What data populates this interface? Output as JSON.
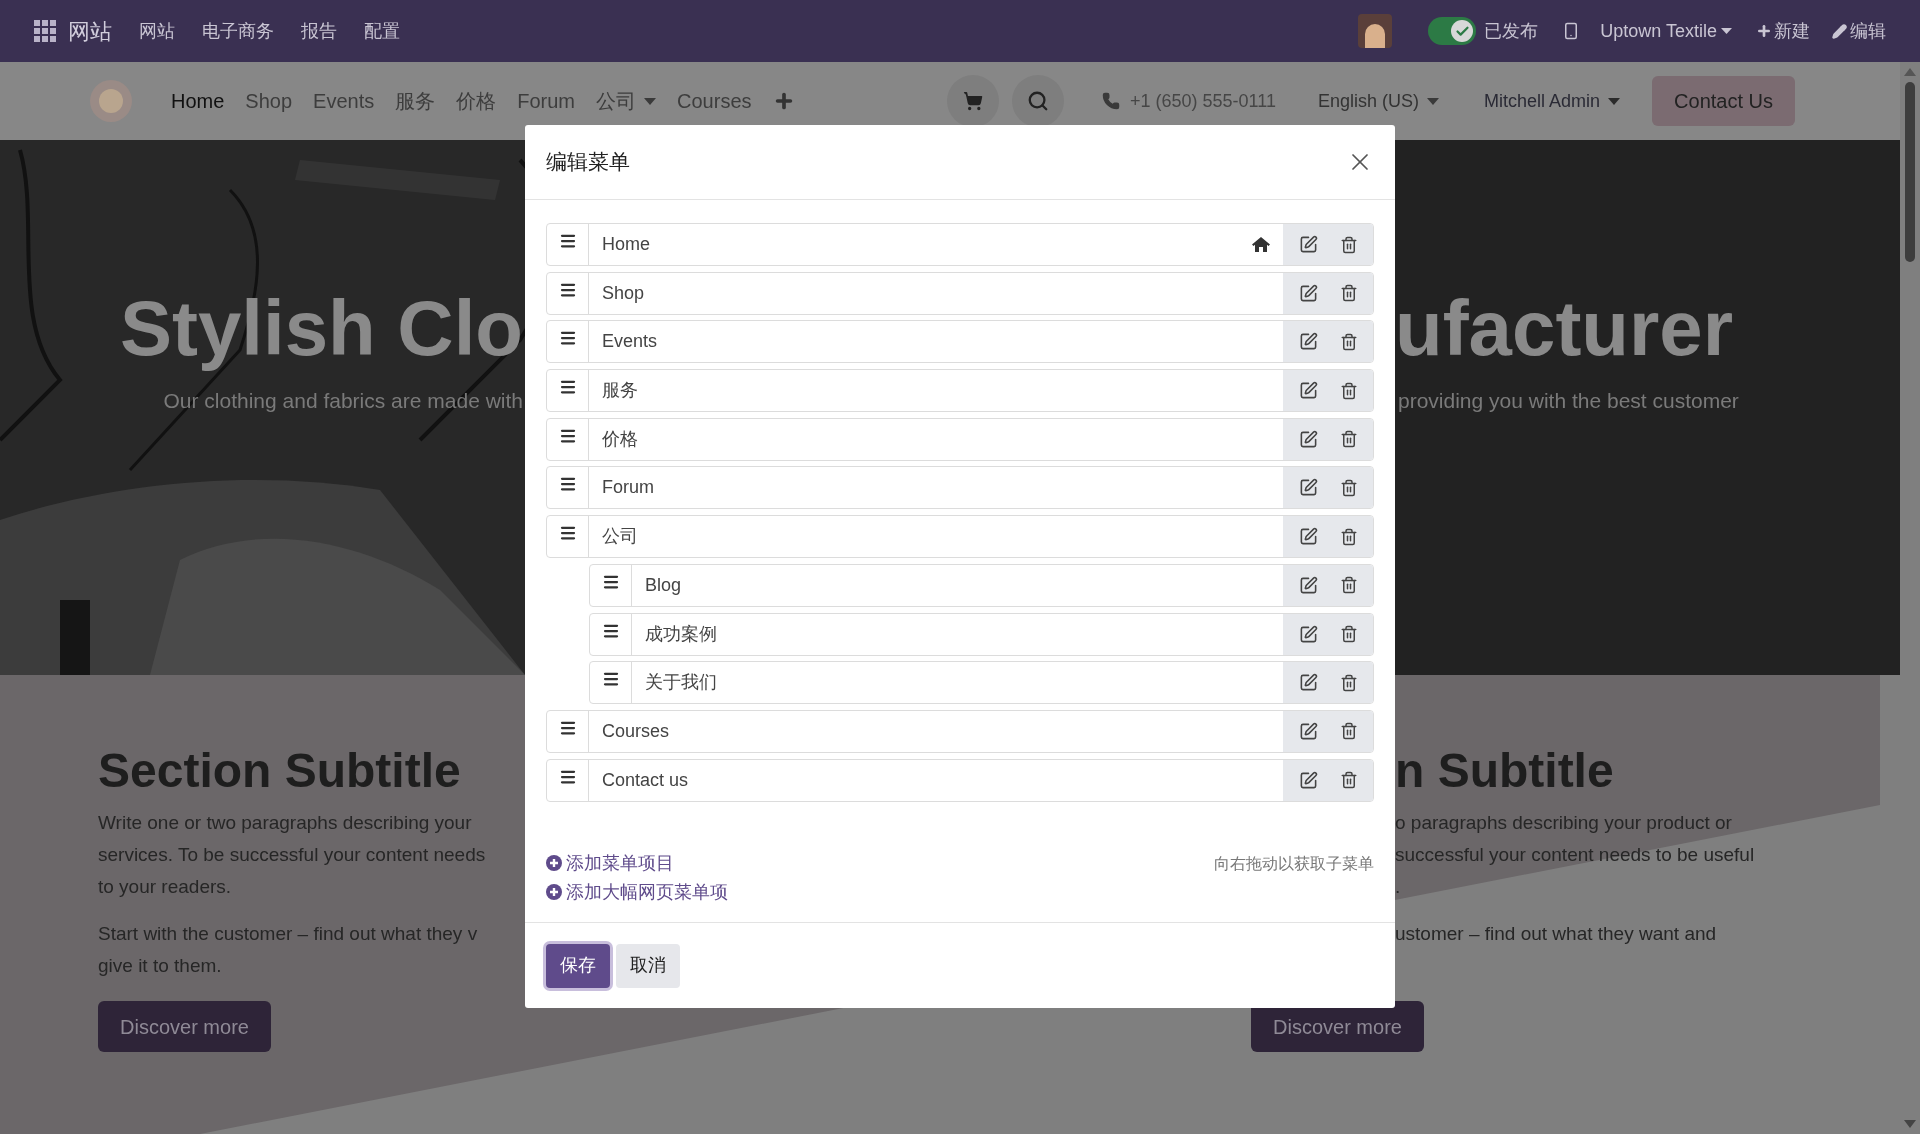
{
  "top_bar": {
    "app_title": "网站",
    "menu": [
      "网站",
      "电子商务",
      "报告",
      "配置"
    ],
    "published": {
      "label": "已发布",
      "on": true
    },
    "website": "Uptown Textile",
    "new": "新建",
    "edit": "编辑"
  },
  "site_nav": {
    "items": [
      {
        "label": "Home",
        "selected": true,
        "dropdown": false
      },
      {
        "label": "Shop",
        "selected": false,
        "dropdown": false
      },
      {
        "label": "Events",
        "selected": false,
        "dropdown": false
      },
      {
        "label": "服务",
        "selected": false,
        "dropdown": false
      },
      {
        "label": "价格",
        "selected": false,
        "dropdown": false
      },
      {
        "label": "Forum",
        "selected": false,
        "dropdown": false
      },
      {
        "label": "公司",
        "selected": false,
        "dropdown": true
      },
      {
        "label": "Courses",
        "selected": false,
        "dropdown": false
      }
    ],
    "phone": "+1 (650) 555-0111",
    "language": "English (US)",
    "user": "Mitchell Admin",
    "cta": "Contact Us"
  },
  "hero": {
    "left_title": "Stylish Clo",
    "right_title": "ufacturer",
    "left_subtitle": "Our clothing and fabrics are made with",
    "right_subtitle": "providing you with the best customer"
  },
  "sections": [
    {
      "title": "Section Subtitle",
      "paragraphs": [
        [
          "Write one or two paragraphs describing your",
          "services. To be successful your content needs",
          "to your readers."
        ],
        [
          "Start with the customer – find out what they v",
          "give it to them."
        ]
      ],
      "button": "Discover more"
    },
    {
      "title": "n Subtitle",
      "paragraphs": [
        [
          "o paragraphs describing your product or",
          "successful your content needs to be useful",
          "."
        ],
        [
          "ustomer – find out what they want and"
        ]
      ],
      "button": "Discover more"
    }
  ],
  "dialog": {
    "title": "编辑菜单",
    "items": [
      {
        "label": "Home",
        "home": true
      },
      {
        "label": "Shop",
        "home": false
      },
      {
        "label": "Events",
        "home": false
      },
      {
        "label": "服务",
        "home": false
      },
      {
        "label": "价格",
        "home": false
      },
      {
        "label": "Forum",
        "home": false
      },
      {
        "label": "公司",
        "home": false,
        "children": [
          {
            "label": "Blog",
            "home": false
          },
          {
            "label": "成功案例",
            "home": false
          },
          {
            "label": "关于我们",
            "home": false
          }
        ]
      },
      {
        "label": "Courses",
        "home": false
      },
      {
        "label": "Contact us",
        "home": false
      }
    ],
    "add_links": [
      "添加菜单项目",
      "添加大幅网页菜单项"
    ],
    "hint": "向右拖动以获取子菜单",
    "buttons": [
      {
        "label": "保存",
        "kind": "primary"
      },
      {
        "label": "取消",
        "kind": "secondary"
      }
    ]
  }
}
